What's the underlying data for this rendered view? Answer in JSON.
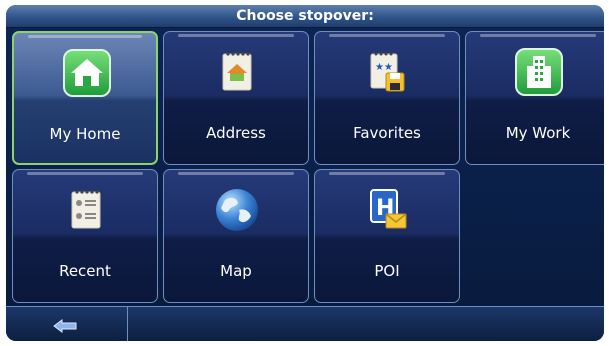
{
  "title": "Choose stopover:",
  "tiles": [
    {
      "label": "My Home",
      "icon": "home-icon",
      "selected": true
    },
    {
      "label": "Address",
      "icon": "address-book-icon"
    },
    {
      "label": "Favorites",
      "icon": "favorites-icon"
    },
    {
      "label": "My Work",
      "icon": "work-building-icon"
    },
    {
      "label": "Recent",
      "icon": "recent-notepad-icon"
    },
    {
      "label": "Map",
      "icon": "globe-icon"
    },
    {
      "label": "POI",
      "icon": "poi-hospital-icon"
    }
  ],
  "bottom": {
    "back_icon": "back-arrow-icon"
  },
  "colors": {
    "title_bg": "#31558a",
    "screen_bg": "#0d2554",
    "selected_border": "#8fd26a",
    "tile_border": "#6f8fbe"
  }
}
